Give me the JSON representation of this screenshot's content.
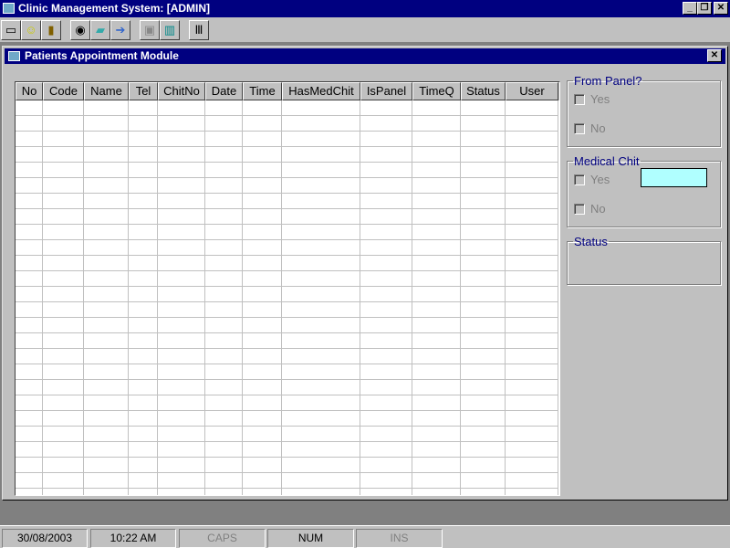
{
  "app": {
    "title": "Clinic Management System: [ADMIN]"
  },
  "toolbar": [
    "window-icon",
    "smiley-icon",
    "exit-door-icon",
    "eye-icon",
    "book-icon",
    "export-icon",
    "form-icon",
    "trash-icon",
    "utensils-icon"
  ],
  "child": {
    "title": "Patients Appointment Module",
    "close": "✕"
  },
  "grid": {
    "columns": [
      "No",
      "Code",
      "Name",
      "Tel",
      "ChitNo",
      "Date",
      "Time",
      "HasMedChit",
      "IsPanel",
      "TimeQ",
      "Status",
      "User"
    ]
  },
  "panel": {
    "from_panel": {
      "legend": "From Panel?",
      "yes": "Yes",
      "no": "No"
    },
    "medical_chit": {
      "legend": "Medical Chit",
      "yes": "Yes",
      "no": "No",
      "value": ""
    },
    "status": {
      "legend": "Status"
    }
  },
  "statusbar": {
    "date": "30/08/2003",
    "time": "10:22 AM",
    "caps": "CAPS",
    "num": "NUM",
    "ins": "INS"
  }
}
